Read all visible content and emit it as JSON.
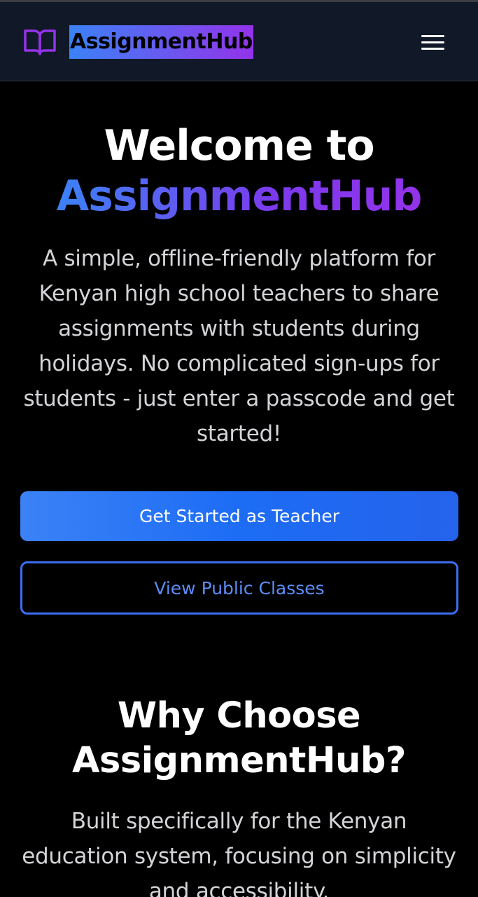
{
  "header": {
    "brand_icon": "book-open-icon",
    "brand_icon_color": "#9333ea",
    "brand_name": "AssignmentHub",
    "menu_icon": "hamburger-menu-icon"
  },
  "hero": {
    "title_line1": "Welcome to",
    "title_line2": "AssignmentHub",
    "description": "A simple, offline-friendly platform for Kenyan high school teachers to share assignments with students during holidays. No complicated sign-ups for students - just enter a passcode and get started!",
    "primary_button": "Get Started as Teacher",
    "secondary_button": "View Public Classes"
  },
  "why": {
    "title": "Why Choose AssignmentHub?",
    "description": "Built specifically for the Kenyan education system, focusing on simplicity and accessibility."
  },
  "colors": {
    "background": "#000000",
    "navbar": "#111827",
    "accent_blue": "#3b82f6",
    "accent_purple": "#9333ea"
  }
}
